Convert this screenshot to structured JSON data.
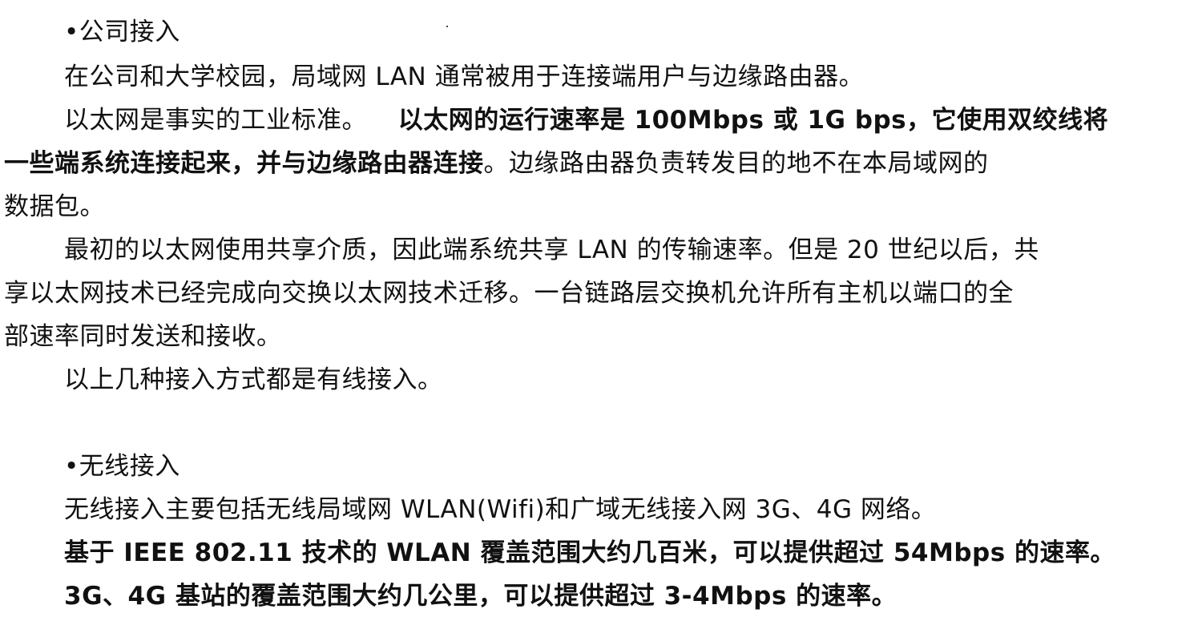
{
  "sections": [
    {
      "heading": "•公司接入",
      "paragraphs": {
        "p1_line1": "在公司和大学校园，局域网 LAN 通常被用于连接端用户与边缘路由器。",
        "p2_line1_normal": "以太网是事实的工业标准。",
        "p2_line1_bold": "以太网的运行速率是 100Mbps 或 1G bps，它使用双绞线将",
        "p2_line2_bold": "一些端系统连接起来，并与边缘路由器连接",
        "p2_line2_normal": "。边缘路由器负责转发目的地不在本局域网的",
        "p2_line3": "数据包。",
        "p3_line1": "最初的以太网使用共享介质，因此端系统共享 LAN 的传输速率。但是 20 世纪以后，共",
        "p3_line2": "享以太网技术已经完成向交换以太网技术迁移。一台链路层交换机允许所有主机以端口的全",
        "p3_line3": "部速率同时发送和接收。",
        "p4_line1": "以上几种接入方式都是有线接入。"
      }
    },
    {
      "heading": "•无线接入",
      "paragraphs": {
        "p1_line1": "无线接入主要包括无线局域网 WLAN(Wifi)和广域无线接入网 3G、4G 网络。",
        "p2_line1_bold": "基于 IEEE 802.11 技术的 WLAN 覆盖范围大约几百米，可以提供超过 54Mbps 的速率。",
        "p3_line1_bold": "3G、4G 基站的覆盖范围大约几公里，可以提供超过 3-4Mbps 的速率。"
      }
    }
  ]
}
